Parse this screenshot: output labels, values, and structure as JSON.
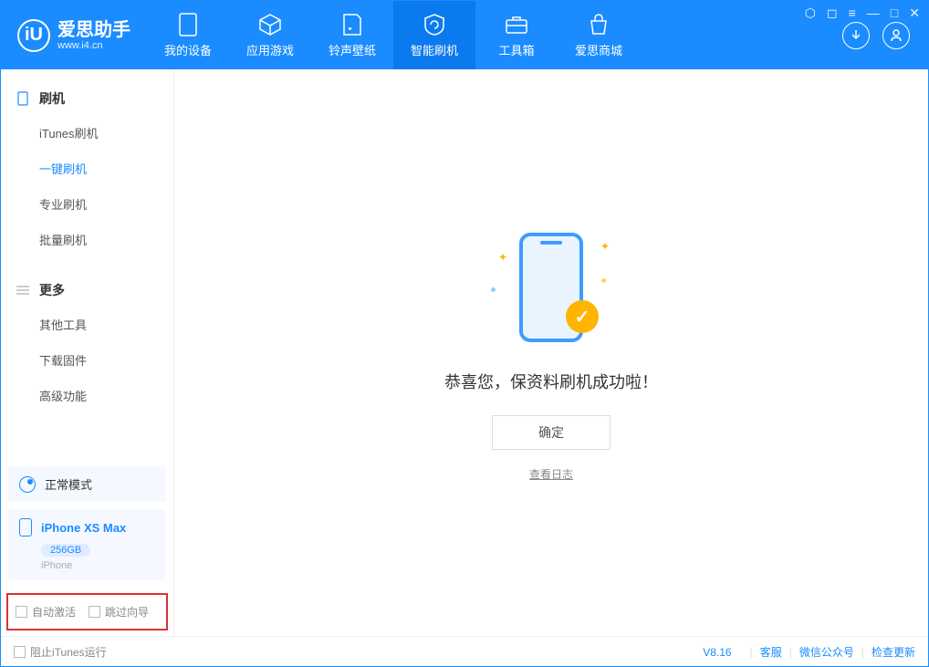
{
  "app": {
    "name": "爱思助手",
    "url": "www.i4.cn"
  },
  "nav": {
    "tabs": [
      "我的设备",
      "应用游戏",
      "铃声壁纸",
      "智能刷机",
      "工具箱",
      "爱思商城"
    ],
    "active_index": 3
  },
  "sidebar": {
    "section1": {
      "title": "刷机",
      "items": [
        "iTunes刷机",
        "一键刷机",
        "专业刷机",
        "批量刷机"
      ],
      "active_index": 1
    },
    "section2": {
      "title": "更多",
      "items": [
        "其他工具",
        "下载固件",
        "高级功能"
      ]
    },
    "mode": "正常模式",
    "device": {
      "name": "iPhone XS Max",
      "capacity": "256GB",
      "type": "iPhone"
    },
    "checkboxes": {
      "auto_activate": "自动激活",
      "skip_guide": "跳过向导"
    }
  },
  "main": {
    "success_text": "恭喜您，保资料刷机成功啦！",
    "ok_button": "确定",
    "log_link": "查看日志"
  },
  "footer": {
    "block_itunes": "阻止iTunes运行",
    "version": "V8.16",
    "links": [
      "客服",
      "微信公众号",
      "检查更新"
    ]
  }
}
